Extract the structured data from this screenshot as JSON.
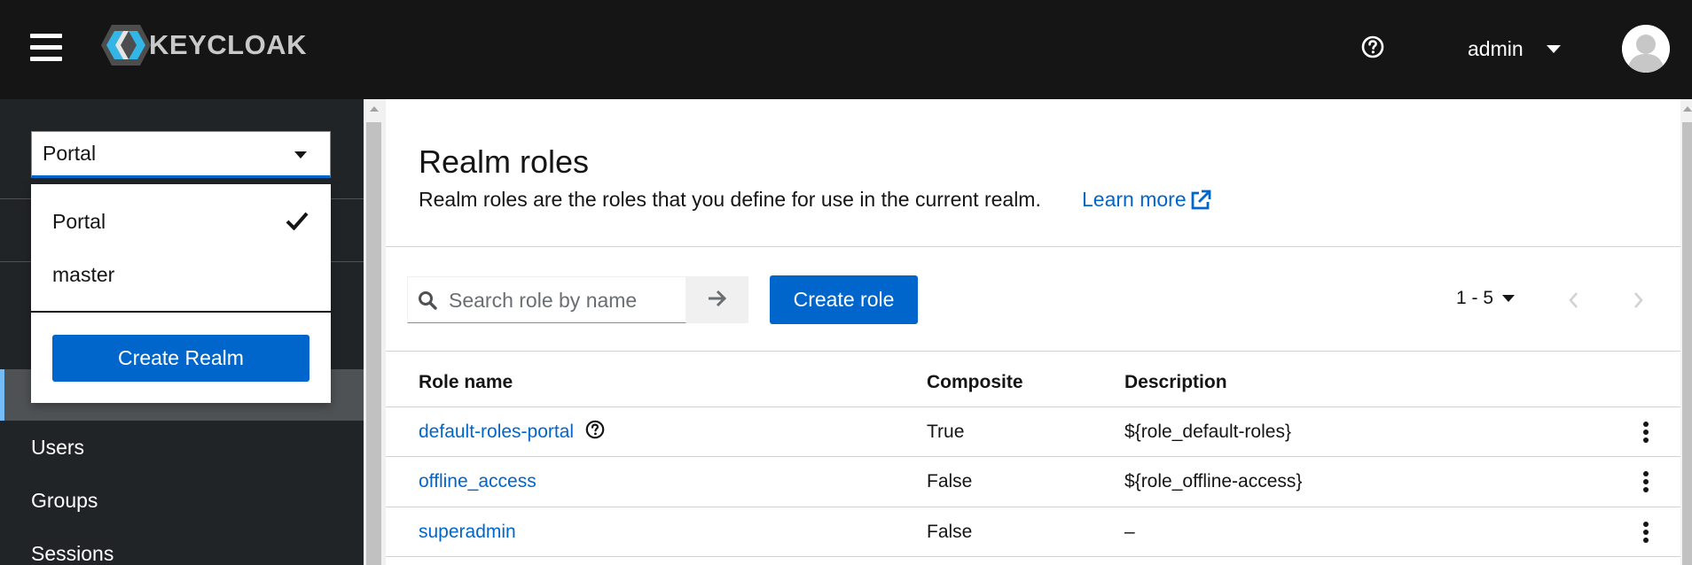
{
  "header": {
    "logo_text": "KEYCLOAK",
    "user_name": "admin"
  },
  "realm_selector": {
    "selected": "Portal",
    "options": [
      "Portal",
      "master"
    ],
    "create_label": "Create Realm"
  },
  "sidebar": {
    "items": [
      "Users",
      "Groups",
      "Sessions"
    ]
  },
  "page": {
    "title": "Realm roles",
    "description": "Realm roles are the roles that you define for use in the current realm.",
    "learn_more": "Learn more"
  },
  "toolbar": {
    "search_placeholder": "Search role by name",
    "create_role_label": "Create role",
    "pagination": "1 - 5"
  },
  "table": {
    "columns": [
      "Role name",
      "Composite",
      "Description"
    ],
    "rows": [
      {
        "name": "default-roles-portal",
        "composite": "True",
        "description": "${role_default-roles}"
      },
      {
        "name": "offline_access",
        "composite": "False",
        "description": "${role_offline-access}"
      },
      {
        "name": "superadmin",
        "composite": "False",
        "description": "–"
      }
    ]
  },
  "colors": {
    "accent": "#0066cc",
    "header_bg": "#151515",
    "sidebar_bg": "#212427",
    "logo_blue": "#33b5e5"
  }
}
